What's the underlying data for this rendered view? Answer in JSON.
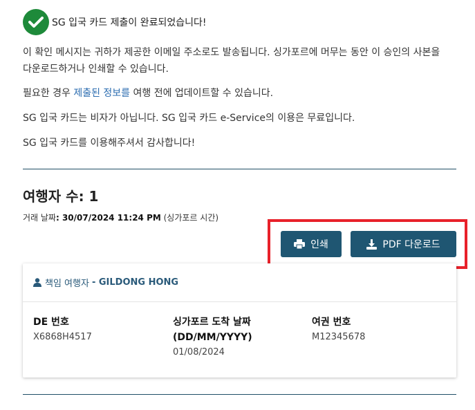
{
  "confirmation": {
    "title": "SG 입국 카드 제출이 완료되었습니다!",
    "email_notice": "이 확인 메시지는 귀하가 제공한 이메일 주소로도 발송됩니다. 싱가포르에 머무는 동안 이 승인의 사본을 다운로드하거나 인쇄할 수 있습니다.",
    "update_prefix": "필요한 경우 ",
    "update_link": "제출된 정보를",
    "update_suffix": " 여행 전에 업데이트할 수 있습니다.",
    "visa_notice": "SG 입국 카드는 비자가 아닙니다. SG 입국 카드 e-Service의 이용은 무료입니다.",
    "thanks": "SG 입국 카드를 이용해주셔서 감사합니다!"
  },
  "summary": {
    "travellers_label": "여행자 수: 1",
    "tx_label": "거래 날짜",
    "tx_value": ": 30/07/2024 11:24 PM",
    "tx_tz": " (싱가포르 시간)"
  },
  "actions": {
    "print_label": "인쇄",
    "pdf_label": "PDF 다운로드"
  },
  "traveller": {
    "role": "책임 여행자",
    "name": "GILDONG HONG",
    "fields": [
      {
        "label": "DE 번호",
        "value": "X6868H4517"
      },
      {
        "label": "싱가포르 도착 날짜 (DD/MM/YYYY)",
        "value": "01/08/2024"
      },
      {
        "label": "여권 번호",
        "value": "M12345678"
      }
    ]
  },
  "colors": {
    "accent": "#1f5672",
    "success": "#1e8a3a",
    "highlight": "#e8212a"
  }
}
